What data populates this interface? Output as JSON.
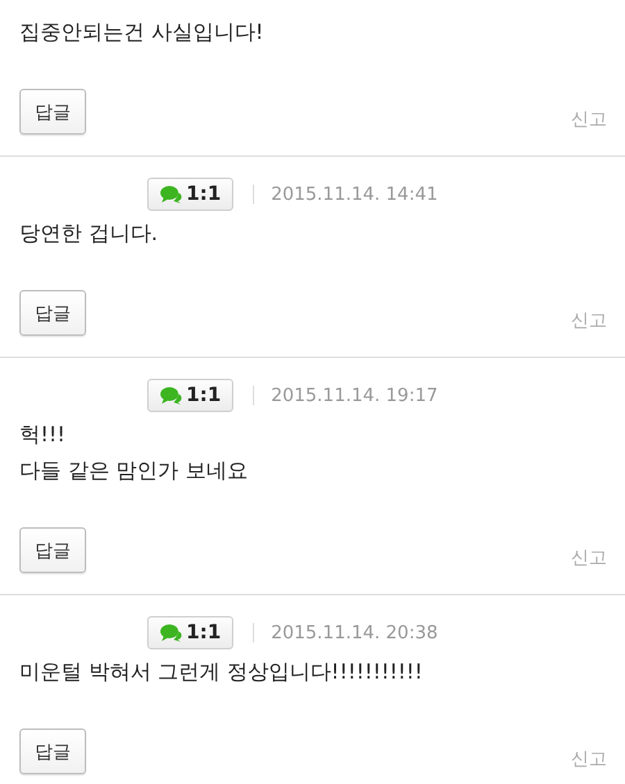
{
  "comments": [
    {
      "lines": [
        "집중안되는건 사실입니다!"
      ],
      "reply": "답글",
      "report": "신고"
    },
    {
      "badge": "1:1",
      "date": "2015.11.14. 14:41",
      "lines": [
        "당연한 겁니다."
      ],
      "reply": "답글",
      "report": "신고"
    },
    {
      "badge": "1:1",
      "date": "2015.11.14. 19:17",
      "lines": [
        "헉!!!",
        "다들 같은 맘인가 보네요"
      ],
      "reply": "답글",
      "report": "신고"
    },
    {
      "badge": "1:1",
      "date": "2015.11.14. 20:38",
      "lines": [
        "미운털 박혀서 그런게 정상입니다!!!!!!!!!!!"
      ],
      "reply": "답글",
      "report": "신고"
    }
  ]
}
